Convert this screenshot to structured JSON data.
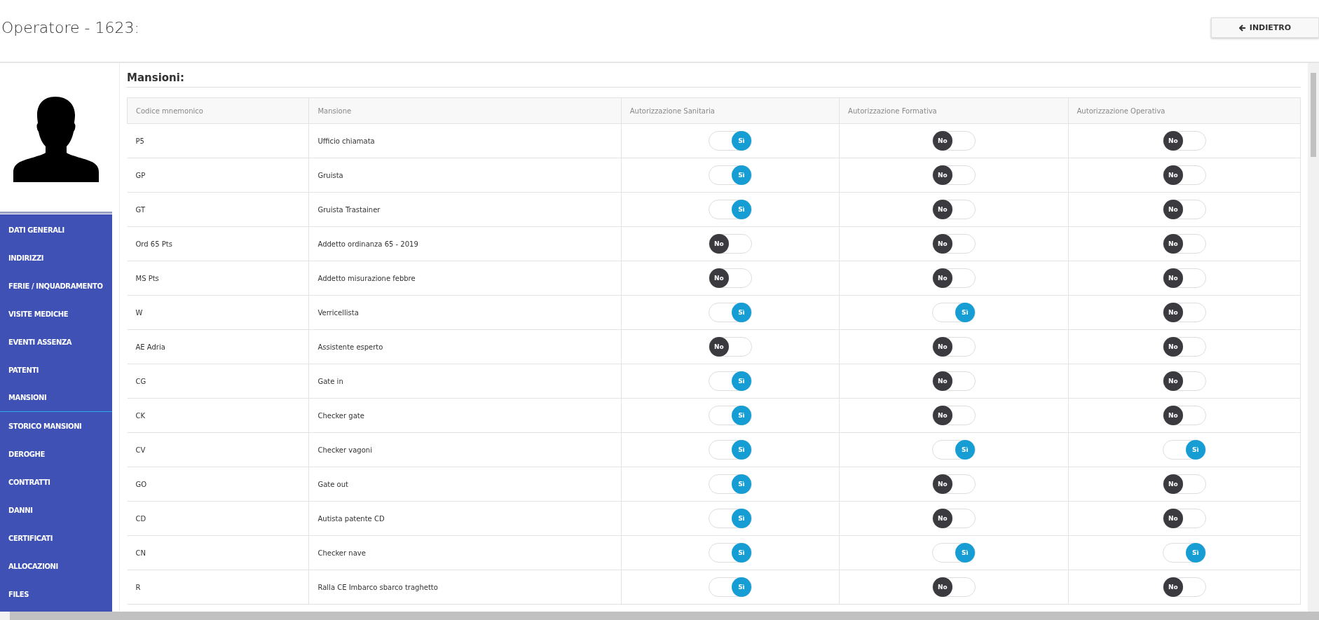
{
  "title": "Operatore - 1623:",
  "back_button": {
    "label": "INDIETRO"
  },
  "sidebar": {
    "items": [
      {
        "label": "DATI GENERALI",
        "selected": false
      },
      {
        "label": "INDIRIZZI",
        "selected": false
      },
      {
        "label": "FERIE / INQUADRAMENTO",
        "selected": false
      },
      {
        "label": "VISITE MEDICHE",
        "selected": false
      },
      {
        "label": "EVENTI ASSENZA",
        "selected": false
      },
      {
        "label": "PATENTI",
        "selected": false
      },
      {
        "label": "MANSIONI",
        "selected": true
      },
      {
        "label": "STORICO MANSIONI",
        "selected": false
      },
      {
        "label": "DEROGHE",
        "selected": false
      },
      {
        "label": "CONTRATTI",
        "selected": false
      },
      {
        "label": "DANNI",
        "selected": false
      },
      {
        "label": "CERTIFICATI",
        "selected": false
      },
      {
        "label": "ALLOCAZIONI",
        "selected": false
      },
      {
        "label": "FILES",
        "selected": false
      }
    ]
  },
  "section_title": "Mansioni:",
  "table": {
    "columns": [
      "Codice mnemonico",
      "Mansione",
      "Autorizzazione Sanitaria",
      "Autorizzazione Formativa",
      "Autorizzazione Operativa"
    ],
    "rows": [
      {
        "code": "P5",
        "name": "Ufficio chiamata",
        "toggles": [
          {
            "on": true,
            "label": "Sì"
          },
          {
            "on": false,
            "label": "No"
          },
          {
            "on": false,
            "label": "No"
          }
        ]
      },
      {
        "code": "GP",
        "name": "Gruista",
        "toggles": [
          {
            "on": true,
            "label": "Sì"
          },
          {
            "on": false,
            "label": "No"
          },
          {
            "on": false,
            "label": "No"
          }
        ]
      },
      {
        "code": "GT",
        "name": "Gruista Trastainer",
        "toggles": [
          {
            "on": true,
            "label": "Sì"
          },
          {
            "on": false,
            "label": "No"
          },
          {
            "on": false,
            "label": "No"
          }
        ]
      },
      {
        "code": "Ord 65 Pts",
        "name": "Addetto ordinanza 65 - 2019",
        "toggles": [
          {
            "on": false,
            "label": "No"
          },
          {
            "on": false,
            "label": "No"
          },
          {
            "on": false,
            "label": "No"
          }
        ]
      },
      {
        "code": "MS Pts",
        "name": "Addetto misurazione febbre",
        "toggles": [
          {
            "on": false,
            "label": "No"
          },
          {
            "on": false,
            "label": "No"
          },
          {
            "on": false,
            "label": "No"
          }
        ]
      },
      {
        "code": "W",
        "name": "Verricellista",
        "toggles": [
          {
            "on": true,
            "label": "Sì"
          },
          {
            "on": true,
            "label": "Sì"
          },
          {
            "on": false,
            "label": "No"
          }
        ]
      },
      {
        "code": "AE Adria",
        "name": "Assistente esperto",
        "toggles": [
          {
            "on": false,
            "label": "No"
          },
          {
            "on": false,
            "label": "No"
          },
          {
            "on": false,
            "label": "No"
          }
        ]
      },
      {
        "code": "CG",
        "name": "Gate in",
        "toggles": [
          {
            "on": true,
            "label": "Sì"
          },
          {
            "on": false,
            "label": "No"
          },
          {
            "on": false,
            "label": "No"
          }
        ]
      },
      {
        "code": "CK",
        "name": "Checker gate",
        "toggles": [
          {
            "on": true,
            "label": "Sì"
          },
          {
            "on": false,
            "label": "No"
          },
          {
            "on": false,
            "label": "No"
          }
        ]
      },
      {
        "code": "CV",
        "name": "Checker vagoni",
        "toggles": [
          {
            "on": true,
            "label": "Sì"
          },
          {
            "on": true,
            "label": "Sì"
          },
          {
            "on": true,
            "label": "Sì"
          }
        ]
      },
      {
        "code": "GO",
        "name": "Gate out",
        "toggles": [
          {
            "on": true,
            "label": "Sì"
          },
          {
            "on": false,
            "label": "No"
          },
          {
            "on": false,
            "label": "No"
          }
        ]
      },
      {
        "code": "CD",
        "name": "Autista patente CD",
        "toggles": [
          {
            "on": true,
            "label": "Sì"
          },
          {
            "on": false,
            "label": "No"
          },
          {
            "on": false,
            "label": "No"
          }
        ]
      },
      {
        "code": "CN",
        "name": "Checker nave",
        "toggles": [
          {
            "on": true,
            "label": "Sì"
          },
          {
            "on": true,
            "label": "Sì"
          },
          {
            "on": true,
            "label": "Sì"
          }
        ]
      },
      {
        "code": "R",
        "name": "Ralla CE Imbarco sbarco traghetto",
        "toggles": [
          {
            "on": true,
            "label": "Sì"
          },
          {
            "on": false,
            "label": "No"
          },
          {
            "on": false,
            "label": "No"
          }
        ]
      }
    ]
  }
}
